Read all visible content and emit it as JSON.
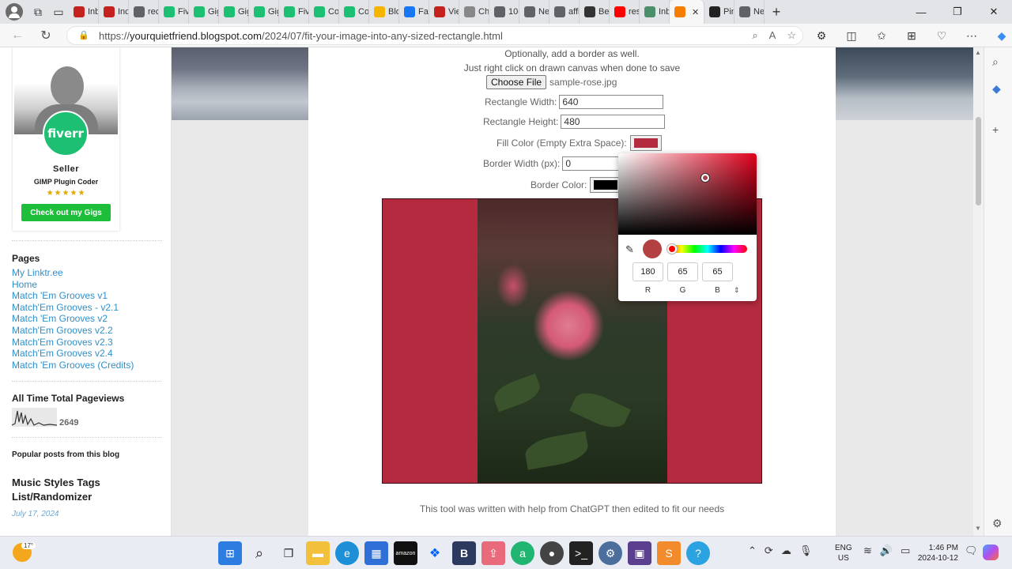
{
  "browser": {
    "tabs": [
      {
        "label": "Inb",
        "color": "#c5221f"
      },
      {
        "label": "Inc",
        "color": "#c5221f"
      },
      {
        "label": "rec",
        "color": "#5f6368"
      },
      {
        "label": "Fiv",
        "color": "#1dbf73"
      },
      {
        "label": "Gig",
        "color": "#1dbf73"
      },
      {
        "label": "Gig",
        "color": "#1dbf73"
      },
      {
        "label": "Gig",
        "color": "#1dbf73"
      },
      {
        "label": "Fiv",
        "color": "#1dbf73"
      },
      {
        "label": "Co",
        "color": "#1dbf73"
      },
      {
        "label": "Cou",
        "color": "#1dbf73"
      },
      {
        "label": "Blo",
        "color": "#f4b400"
      },
      {
        "label": "Fac",
        "color": "#1877f2"
      },
      {
        "label": "Vie",
        "color": "#c5221f"
      },
      {
        "label": "Cha",
        "color": "#888888"
      },
      {
        "label": "10-",
        "color": "#5f6368"
      },
      {
        "label": "Ne",
        "color": "#5f6368"
      },
      {
        "label": "affi",
        "color": "#5f6368"
      },
      {
        "label": "Bes",
        "color": "#333333"
      },
      {
        "label": "res",
        "color": "#ff0000"
      },
      {
        "label": "Inb",
        "color": "#4a8f6a"
      }
    ],
    "active_tab": {
      "label": "",
      "color": "#f57d00"
    },
    "trailing_tabs": [
      {
        "label": "Pin",
        "color": "#222222"
      },
      {
        "label": "Ne",
        "color": "#5f6368"
      }
    ],
    "url_prefix": "https://",
    "url_host": "yourquietfriend.blogspot.com",
    "url_path": "/2024/07/fit-your-image-into-any-sized-rectangle.html"
  },
  "sidebar": {
    "seller_badge": "fiverr",
    "seller_title": "Seller",
    "seller_subtitle": "GIMP Plugin Coder",
    "stars": "★★★★★",
    "gigs_button": "Check out my Gigs",
    "pages_heading": "Pages",
    "pages": [
      "My Linktr.ee",
      "Home",
      "Match 'Em Grooves v1",
      "Match'Em Grooves - v2.1",
      "Match 'Em Grooves v2",
      "Match'Em Grooves v2.2",
      "Match'Em Grooves v2.3",
      "Match'Em Grooves v2.4",
      "Match 'Em Grooves (Credits)"
    ],
    "pageviews_heading": "All Time Total Pageviews",
    "pageviews_count": "2649",
    "popular_heading": "Popular posts from this blog",
    "post_title": "Music Styles Tags List/Randomizer",
    "post_date": "July 17, 2024"
  },
  "tool": {
    "line_border": "Optionally, add a border as well.",
    "line_save": "Just right click on drawn canvas when done to save",
    "choose_file_label": "Choose File",
    "file_name": "sample-rose.jpg",
    "width_label": "Rectangle Width:",
    "width_value": "640",
    "height_label": "Rectangle Height:",
    "height_value": "480",
    "fill_label": "Fill Color (Empty Extra Space):",
    "fill_color": "#b42a3e",
    "border_width_label": "Border Width (px):",
    "border_width_value": "0",
    "border_color_label": "Border Color:",
    "border_color": "#000000",
    "footer_note": "This tool was written with help from ChatGPT then edited to fit our needs"
  },
  "color_picker": {
    "current_color": "#b44141",
    "r": "180",
    "g": "65",
    "b": "65",
    "r_label": "R",
    "g_label": "G",
    "b_label": "B"
  },
  "taskbar": {
    "temperature": "17°",
    "lang_line1": "ENG",
    "lang_line2": "US",
    "time": "1:46 PM",
    "date": "2024-10-12"
  }
}
